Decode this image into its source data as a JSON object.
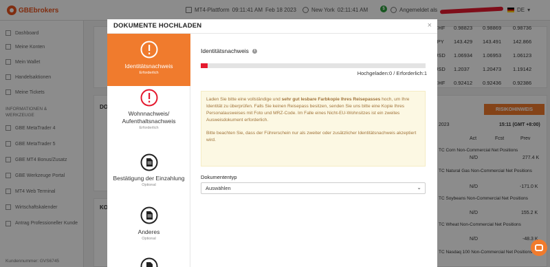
{
  "topbar": {
    "logo": "GBEbrokers",
    "platform": "MT4-Plattform",
    "platform_time": "09:11:41 AM",
    "platform_date": "Feb 18 2023",
    "city": "New York",
    "city_time": "02:11:41 AM",
    "logged_in": "Angemeldet als",
    "lang": "DE"
  },
  "sidebar": {
    "items": [
      "Dashboard",
      "Meine Konten",
      "Mein Wallet",
      "Handelsaktionen",
      "Meine Tickets"
    ],
    "heading": "INFORMATIONEN & WERKZEUGE",
    "tools": [
      "GBE MetaTrader 4",
      "GBE MetaTrader 5",
      "GBE MT4 Bonus/Zusatz",
      "GBE Werkzeuge Portal",
      "MT4 Web Terminal",
      "Wirtschaftskalender",
      "Antrag Professioneller Kunde"
    ],
    "customer_no": "Kundennummer: GVS6745"
  },
  "rates": [
    {
      "sym": "CHF",
      "a": "0.98823",
      "b": "0.98869",
      "c": "0.98736"
    },
    {
      "sym": "JPY",
      "a": "143.429",
      "b": "143.491",
      "c": "142.866"
    },
    {
      "sym": "USD",
      "a": "1.06934",
      "b": "1.06953",
      "c": "1.06123"
    },
    {
      "sym": "USD",
      "a": "1.2037",
      "b": "1.20473",
      "c": "1.19142"
    },
    {
      "sym": "CHF",
      "a": "0.92412",
      "b": "0.92436",
      "c": "0.92386"
    }
  ],
  "news": {
    "button": "RISIKOHINWEIS",
    "date": "2023",
    "time": "15:11 (GMT +8:00)",
    "cols": [
      "Act",
      "Fcst",
      "Prev"
    ],
    "items": [
      {
        "label": "TC Corn Non-Commercial Net Positions",
        "act": "N/D",
        "prev": "277.4 K"
      },
      {
        "label": "TC Natural Gas Non-Commercial Net Positions",
        "act": "N/D",
        "prev": "-171.0 K"
      },
      {
        "label": "TC Soybeans Non-Commercial Net Positions",
        "act": "N/D",
        "prev": "155.2 K"
      },
      {
        "label": "TC Wheat Non-Commercial Net Positions",
        "act": "N/D",
        "prev": "-48.3 K"
      },
      {
        "label": "TC Nasdaq 100 Non-Commercial Net Positions",
        "act": "",
        "prev": ""
      }
    ],
    "left_labels": [
      "DO",
      "KO"
    ]
  },
  "modal": {
    "title": "DOKUMENTE HOCHLADEN",
    "close": "×",
    "steps": [
      {
        "title": "Identitätsnachweis",
        "sub": "Erforderlich"
      },
      {
        "title": "Wohnnachweis/ Aufenthaltsnachweis",
        "sub": "Erforderlich"
      },
      {
        "title": "Bestätigung der Einzahlung",
        "sub": "Optional"
      },
      {
        "title": "Anderes",
        "sub": "Optional"
      }
    ],
    "section_title": "Identitätsnachweis",
    "progress_fraction": 0.03,
    "progress_text": "Hochgeladen:0 / Erforderlich:1",
    "notice_p1_a": "Laden Sie bitte eine vollständige und ",
    "notice_p1_b": "sehr gut lesbare Farbkopie Ihres Reisepasses",
    "notice_p1_c": " hoch, um Ihre Identität zu überprüfen. Falls Sie keinen Reisepass besitzen, senden Sie uns bitte eine Kopie Ihres Personalausweises mit Foto und MRZ-Code. Im Falle eines Nicht-EU-Wohnsitzes ist ein zweites Ausweisdokument erforderlich.",
    "notice_p2": "Bitte beachten Sie, dass der Führerschein nur als zweiter oder zusätzlicher Identitätsnachweis akzeptiert wird.",
    "doc_type_label": "Dokumententyp",
    "doc_type_value": "Auswählen"
  },
  "colors": {
    "accent": "#f07b2d",
    "progress": "#e5192e",
    "notice_bg": "#fcf8e3"
  }
}
